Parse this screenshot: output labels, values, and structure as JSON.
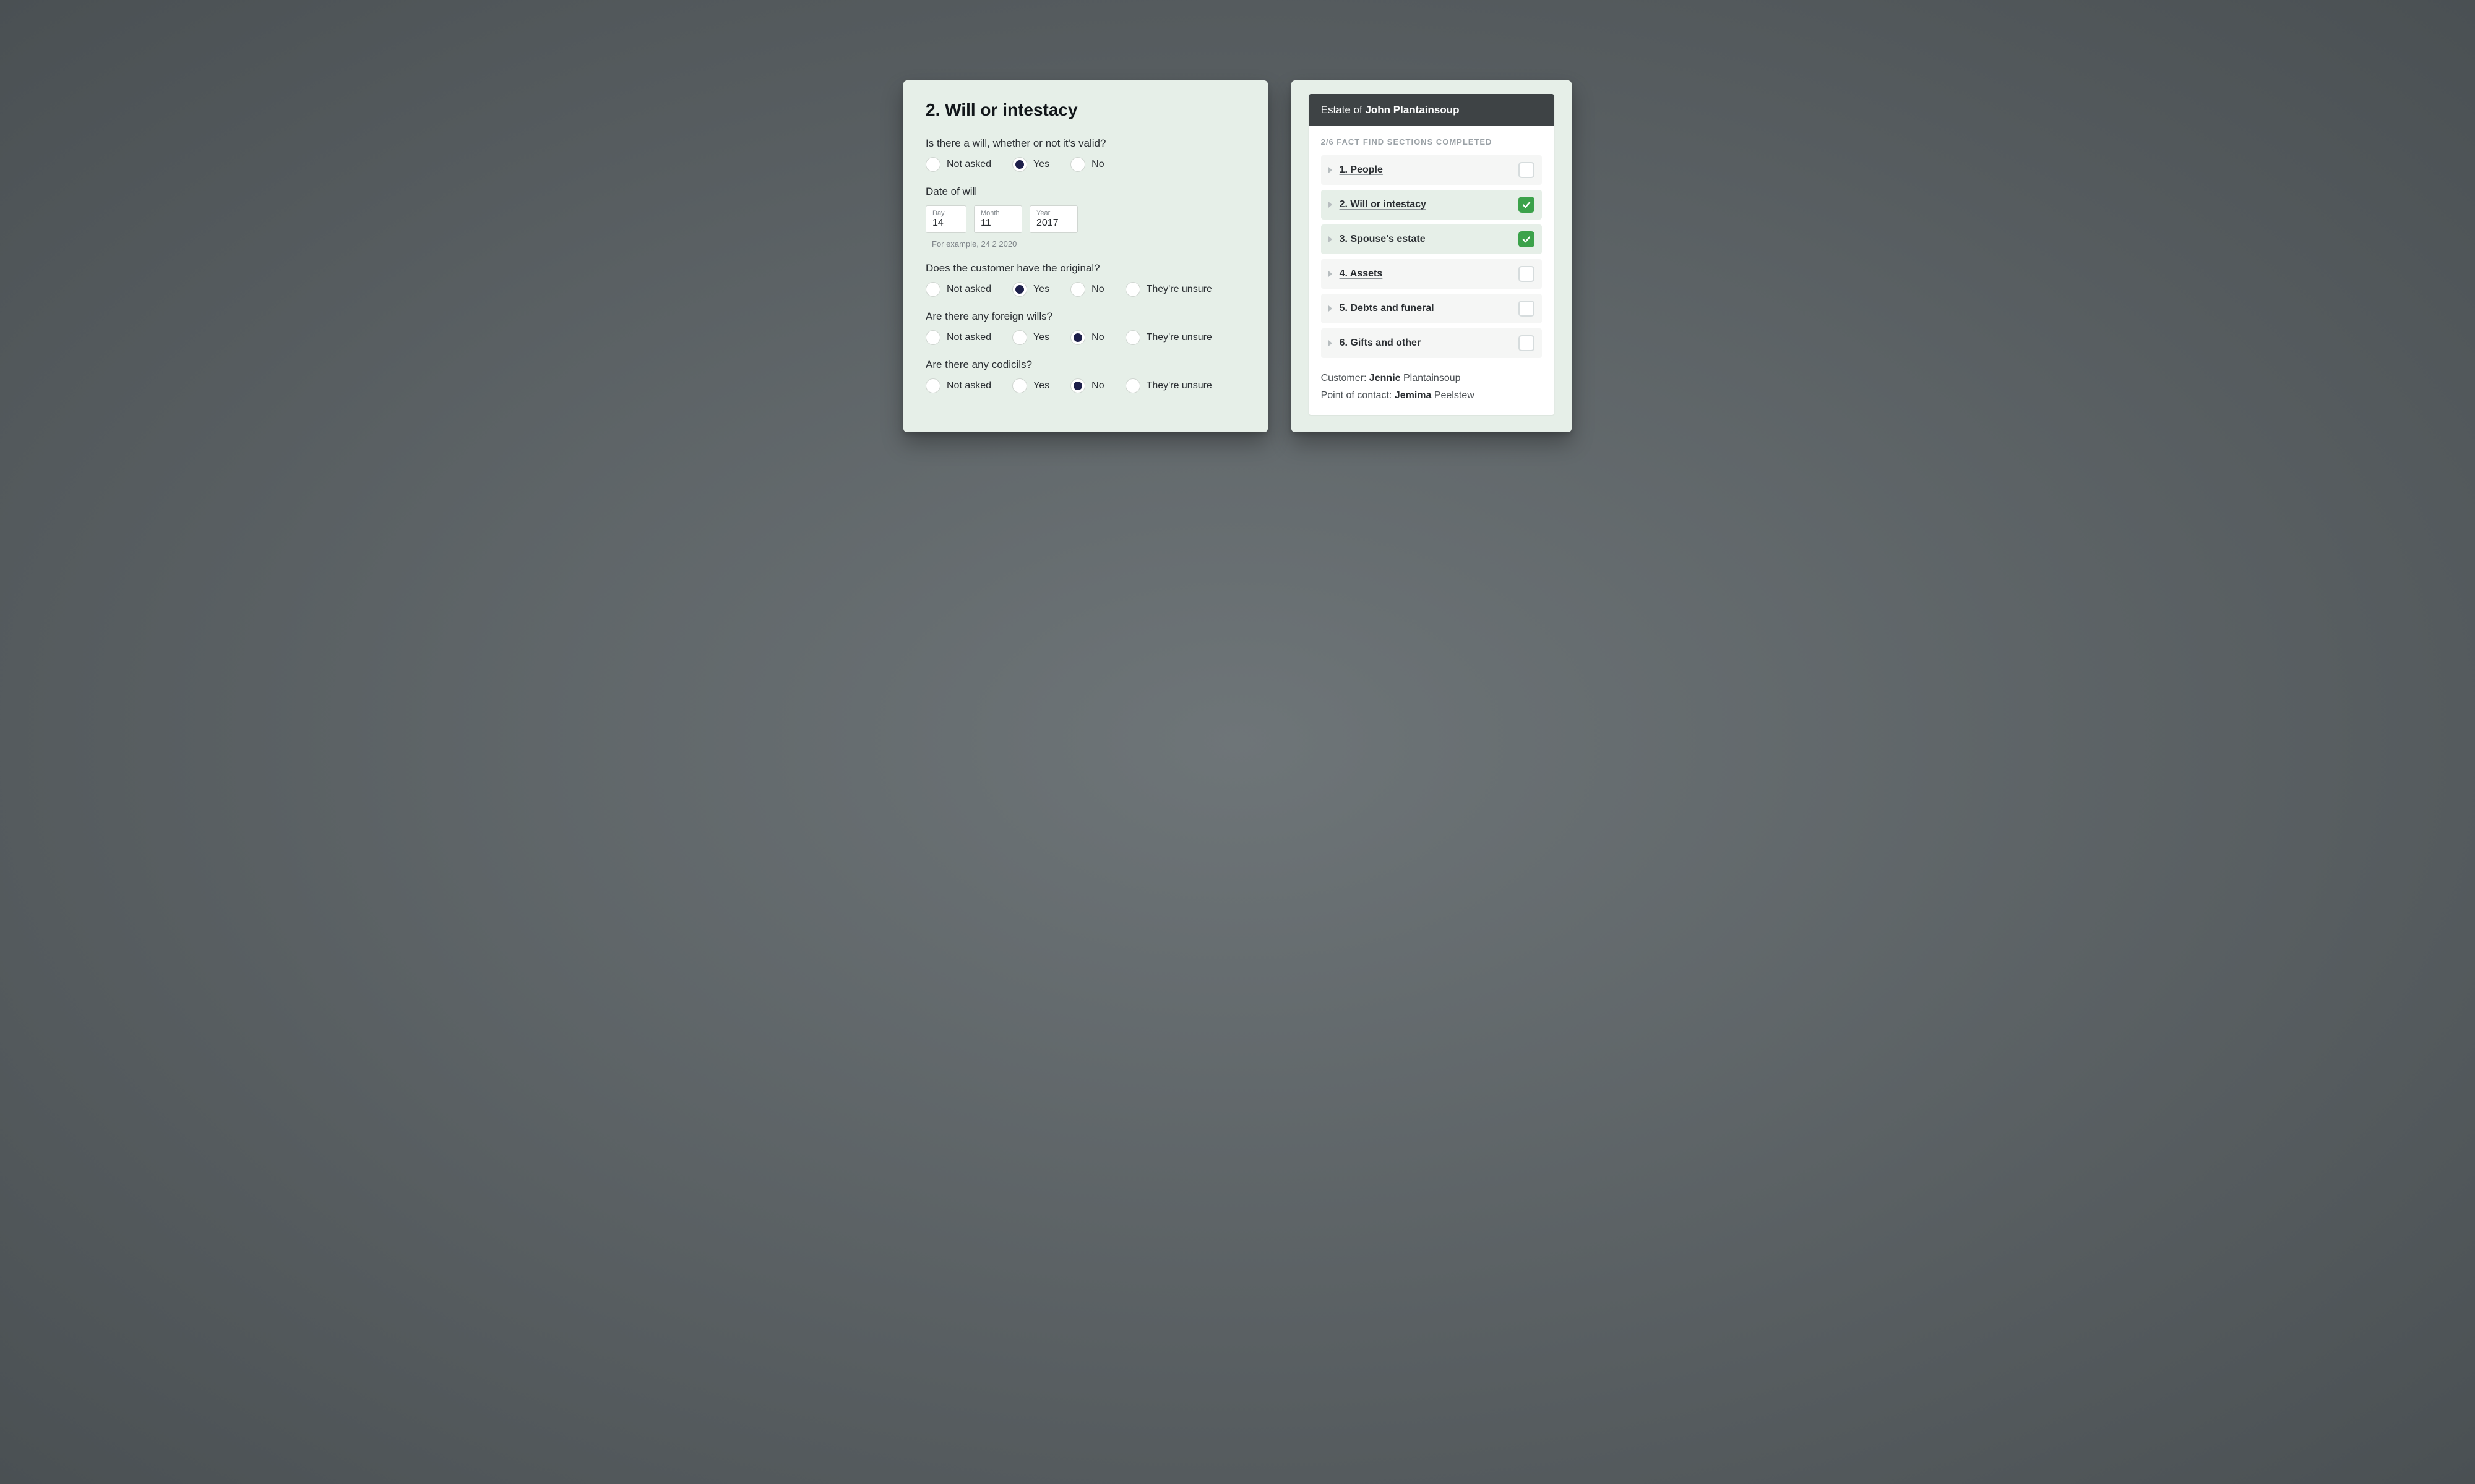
{
  "form": {
    "title": "2. Will or intestacy",
    "q_will": {
      "label": "Is there a will, whether or not it's valid?",
      "options": [
        "Not asked",
        "Yes",
        "No"
      ],
      "selected": 1
    },
    "date_of_will": {
      "label": "Date of will",
      "day_label": "Day",
      "month_label": "Month",
      "year_label": "Year",
      "day": "14",
      "month": "11",
      "year": "2017",
      "hint": "For example, 24 2 2020"
    },
    "q_original": {
      "label": "Does the customer have the original?",
      "options": [
        "Not asked",
        "Yes",
        "No",
        "They're unsure"
      ],
      "selected": 1
    },
    "q_foreign": {
      "label": "Are there any foreign wills?",
      "options": [
        "Not asked",
        "Yes",
        "No",
        "They're unsure"
      ],
      "selected": 2
    },
    "q_codicils": {
      "label": "Are there any codicils?",
      "options": [
        "Not asked",
        "Yes",
        "No",
        "They're unsure"
      ],
      "selected": 2
    }
  },
  "sidebar": {
    "estate_prefix": "Estate of ",
    "estate_name": "John Plantainsoup",
    "progress_text": "2/6 FACT FIND SECTIONS COMPLETED",
    "sections": [
      {
        "label": "1. People",
        "completed": false
      },
      {
        "label": "2. Will or intestacy",
        "completed": true
      },
      {
        "label": "3. Spouse's estate",
        "completed": true
      },
      {
        "label": "4. Assets",
        "completed": false
      },
      {
        "label": "5. Debts and funeral",
        "completed": false
      },
      {
        "label": "6. Gifts and other",
        "completed": false
      }
    ],
    "customer_label": "Customer: ",
    "customer_name_bold": "Jennie",
    "customer_name_rest": " Plantainsoup",
    "poc_label": "Point of contact: ",
    "poc_name_bold": "Jemima",
    "poc_name_rest": " Peelstew"
  }
}
